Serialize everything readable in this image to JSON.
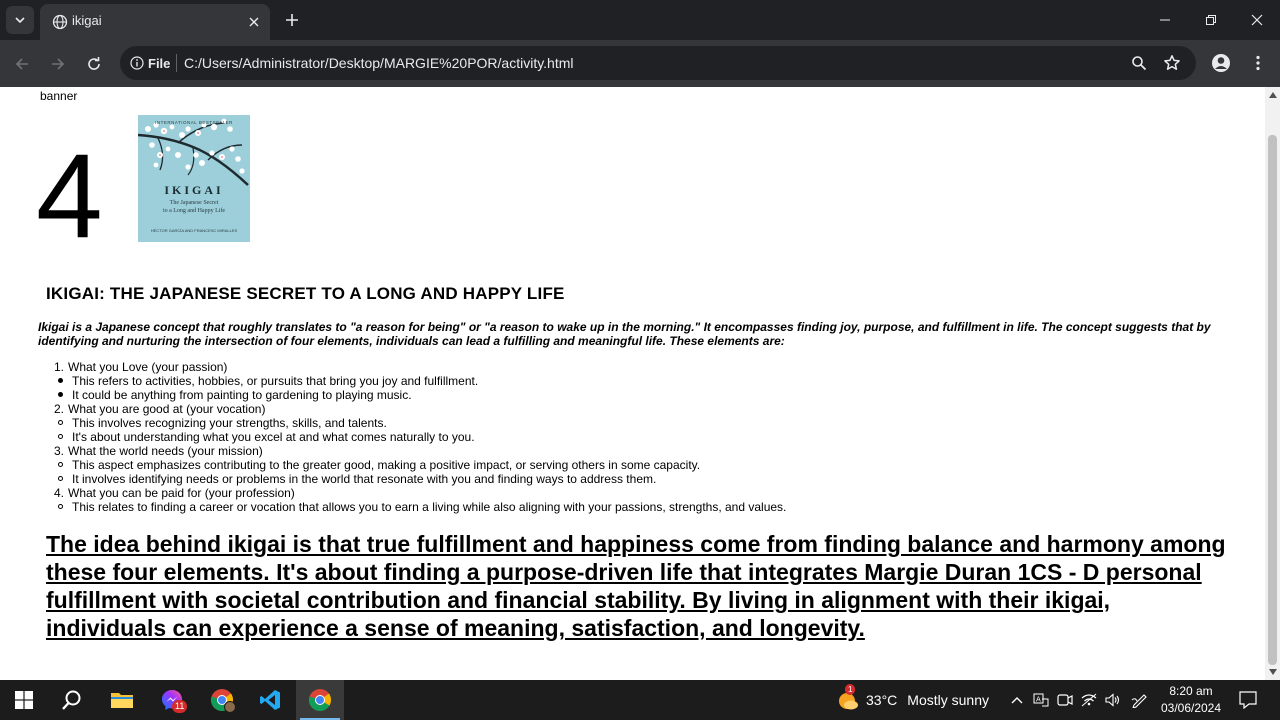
{
  "browser": {
    "tab_title": "ikigai",
    "url_chip": "File",
    "url": "C:/Users/Administrator/Desktop/MARGIE%20POR/activity.html"
  },
  "page": {
    "banner_alt": "banner",
    "big_number": "4",
    "book": {
      "top_text": "INTERNATIONAL BESTSELLER",
      "title": "IKIGAI",
      "subtitle_line1": "The Japanese Secret",
      "subtitle_line2": "to a Long and Happy Life",
      "bottom_text": "HÉCTOR GARCÍA AND FRANCESC MIRALLES"
    },
    "heading": "IKIGAI: THE JAPANESE SECRET TO A LONG AND HAPPY LIFE",
    "intro": "Ikigai is a Japanese concept that roughly translates to \"a reason for being\" or \"a reason to wake up in the morning.\" It encompasses finding joy, purpose, and fulfillment in life. The concept suggests that by identifying and nurturing the intersection of four elements, individuals can lead a fulfilling and meaningful life. These elements are:",
    "elements": [
      {
        "number": "1.",
        "label": "What you Love (your passion)",
        "bullet_style": "disc",
        "points": [
          "This refers to activities, hobbies, or pursuits that bring you joy and fulfillment.",
          "It could be anything from painting to gardening to playing music."
        ]
      },
      {
        "number": "2.",
        "label": "What you are good at (your vocation)",
        "bullet_style": "circle",
        "points": [
          "This involves recognizing your strengths, skills, and talents.",
          "It's about understanding what you excel at and what comes naturally to you."
        ]
      },
      {
        "number": "3.",
        "label": "What the world needs (your mission)",
        "bullet_style": "circle",
        "points": [
          "This aspect emphasizes contributing to the greater good, making a positive impact, or serving others in some capacity.",
          "It involves identifying needs or problems in the world that resonate with you and finding ways to address them."
        ]
      },
      {
        "number": "4.",
        "label": "What you can be paid for (your profession)",
        "bullet_style": "circle",
        "points": [
          "This relates to finding a career or vocation that allows you to earn a living while also aligning with your passions, strengths, and values."
        ]
      }
    ],
    "conclusion": "The idea behind ikigai is that true fulfillment and happiness come from finding balance and harmony among these four elements. It's about finding a purpose-driven life that integrates Margie Duran 1CS - D personal fulfillment with societal contribution and financial stability. By living in alignment with their ikigai, individuals can experience a sense of meaning, satisfaction, and longevity."
  },
  "taskbar": {
    "messenger_badge": "11",
    "weather_badge": "1",
    "weather_temp": "33°C",
    "weather_text": "Mostly sunny",
    "time": "8:20 am",
    "date": "03/06/2024"
  },
  "colors": {
    "tab_bg": "#35363a",
    "frame_bg": "#202124",
    "taskbar_bg": "#1c1c1c",
    "accent": "#76b9ed"
  }
}
